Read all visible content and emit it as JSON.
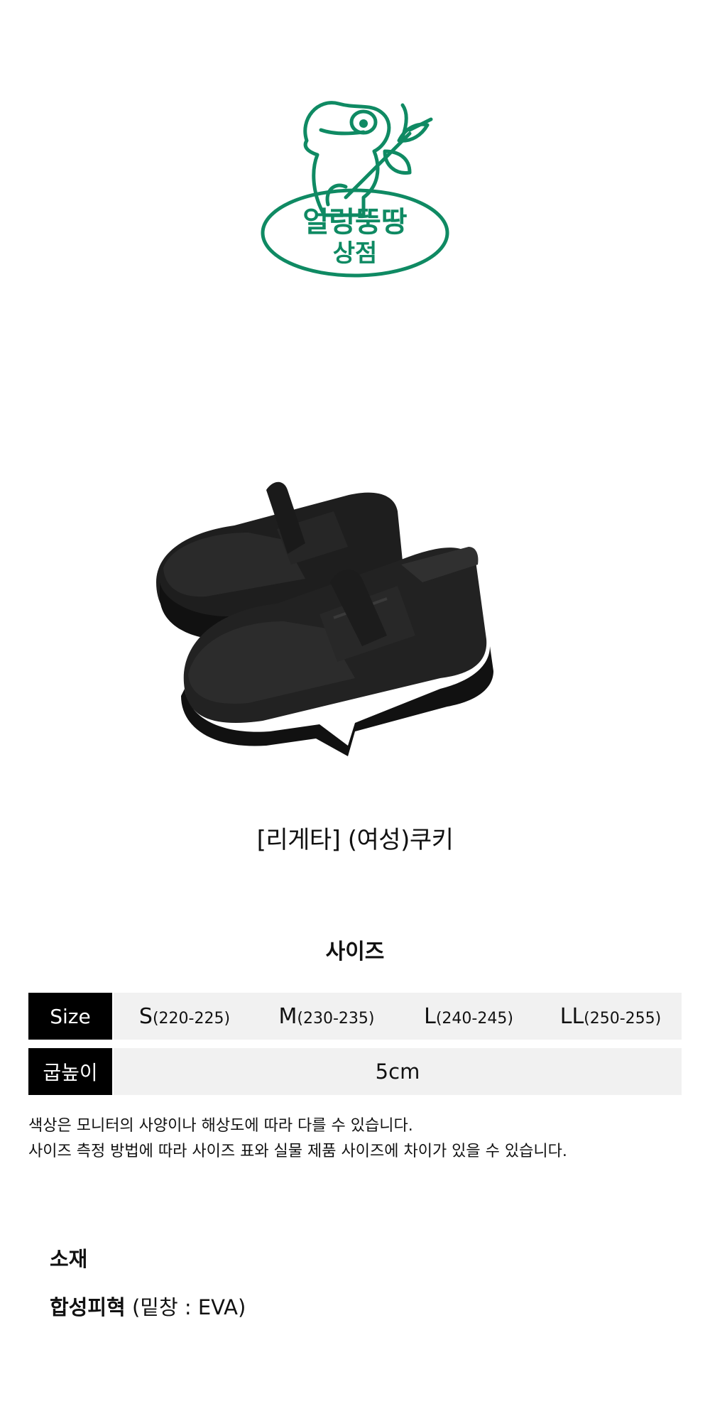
{
  "logo": {
    "text_line1": "얼렁뚱땅",
    "text_line2": "상점",
    "color": "#0f8a63"
  },
  "product": {
    "name": "[리게타] (여성)쿠키"
  },
  "size_section": {
    "heading": "사이즈",
    "size_label": "Size",
    "sizes": [
      {
        "letter": "S",
        "range": "(220-225)"
      },
      {
        "letter": "M",
        "range": "(230-235)"
      },
      {
        "letter": "L",
        "range": "(240-245)"
      },
      {
        "letter": "LL",
        "range": "(250-255)"
      }
    ],
    "heel_label": "굽높이",
    "heel_value": "5cm",
    "notes": [
      "색상은 모니터의 사양이나 해상도에 따라 다를 수 있습니다.",
      "사이즈 측정 방법에 따라 사이즈 표와 실물 제품 사이즈에 차이가 있을 수 있습니다."
    ]
  },
  "material": {
    "heading": "소재",
    "main": "합성피혁",
    "detail": "(밑창 : EVA)"
  },
  "colors": {
    "label_bg": "#000000",
    "cell_bg": "#f1f1f1",
    "logo_green": "#0f8a63"
  }
}
